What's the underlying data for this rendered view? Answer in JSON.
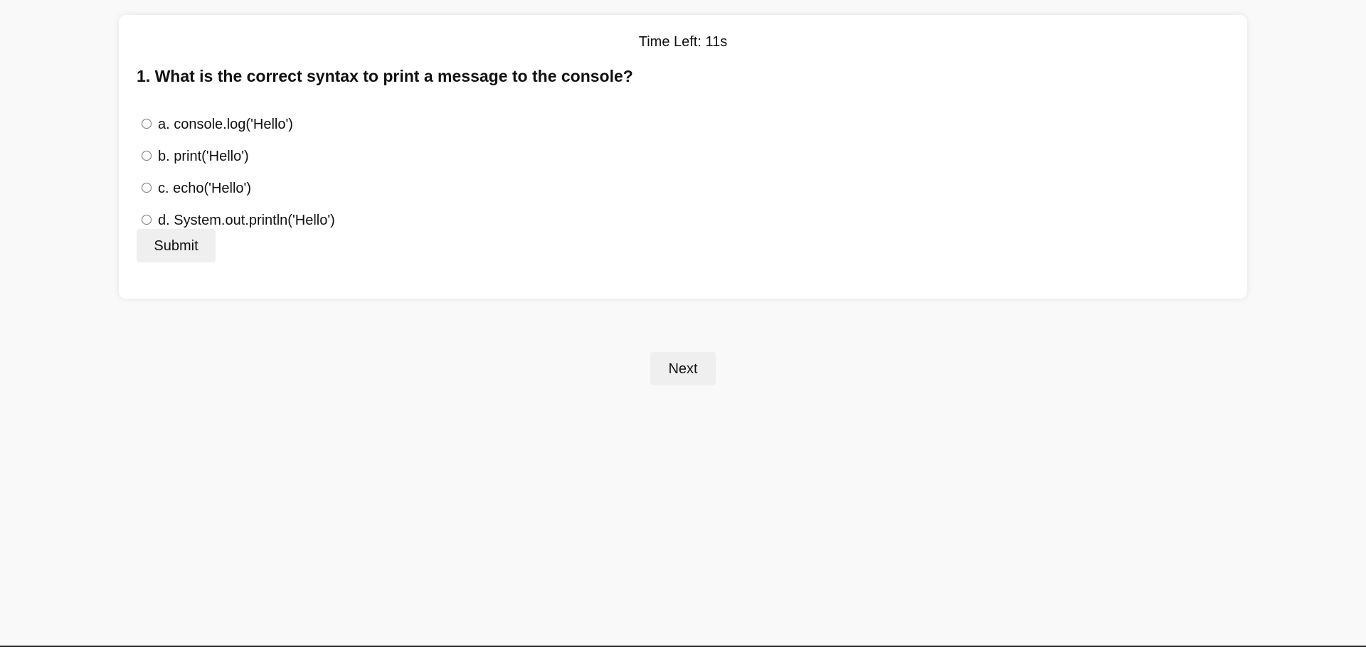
{
  "timer": {
    "text": "Time Left: 11s"
  },
  "question": {
    "text": "1. What is the correct syntax to print a message to the console?",
    "options": [
      {
        "label": "a. console.log('Hello')",
        "selected": false
      },
      {
        "label": "b. print('Hello')",
        "selected": false
      },
      {
        "label": "c. echo('Hello')",
        "selected": false
      },
      {
        "label": "d. System.out.println('Hello')",
        "selected": false
      }
    ]
  },
  "actions": {
    "submit_label": "Submit",
    "next_label": "Next"
  },
  "colors": {
    "page_background": "#f9f9f9",
    "card_background": "#ffffff",
    "button_background": "#efefef",
    "text": "#111111"
  },
  "icons": {
    "option_marker": "radio-button-icon"
  }
}
